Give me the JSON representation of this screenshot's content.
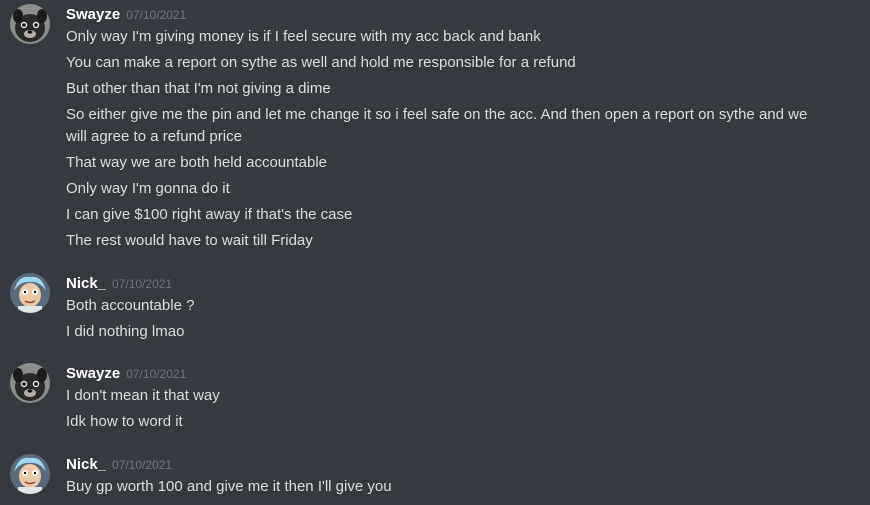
{
  "colors": {
    "background": "#36393f",
    "username": "#ffffff",
    "timestamp": "#72767d",
    "text": "#dcddde"
  },
  "messages": [
    {
      "author": "Swayze",
      "avatar": "pug-dog-avatar",
      "timestamp": "07/10/2021",
      "lines": [
        "Only way I'm giving money is if I feel secure with my acc back and bank",
        "You can make a report on sythe as well and hold me responsible for a refund",
        "But other than that I'm not giving a dime",
        "So either give me the pin and let me change it so i feel safe on the acc. And then open a report on sythe and we will agree to a refund price",
        "That way we are both held accountable",
        "Only way I'm gonna do it",
        "I can give $100 right away if that's the case",
        "The rest would have to wait till Friday"
      ]
    },
    {
      "author": "Nick_",
      "avatar": "cartoon-scientist-avatar",
      "timestamp": "07/10/2021",
      "lines": [
        "Both accountable ?",
        "I did nothing lmao"
      ]
    },
    {
      "author": "Swayze",
      "avatar": "pug-dog-avatar",
      "timestamp": "07/10/2021",
      "lines": [
        "I don't mean it that way",
        "Idk how to word it"
      ]
    },
    {
      "author": "Nick_",
      "avatar": "cartoon-scientist-avatar",
      "timestamp": "07/10/2021",
      "lines": [
        "Buy gp worth 100 and give me it then I'll give you"
      ]
    }
  ]
}
